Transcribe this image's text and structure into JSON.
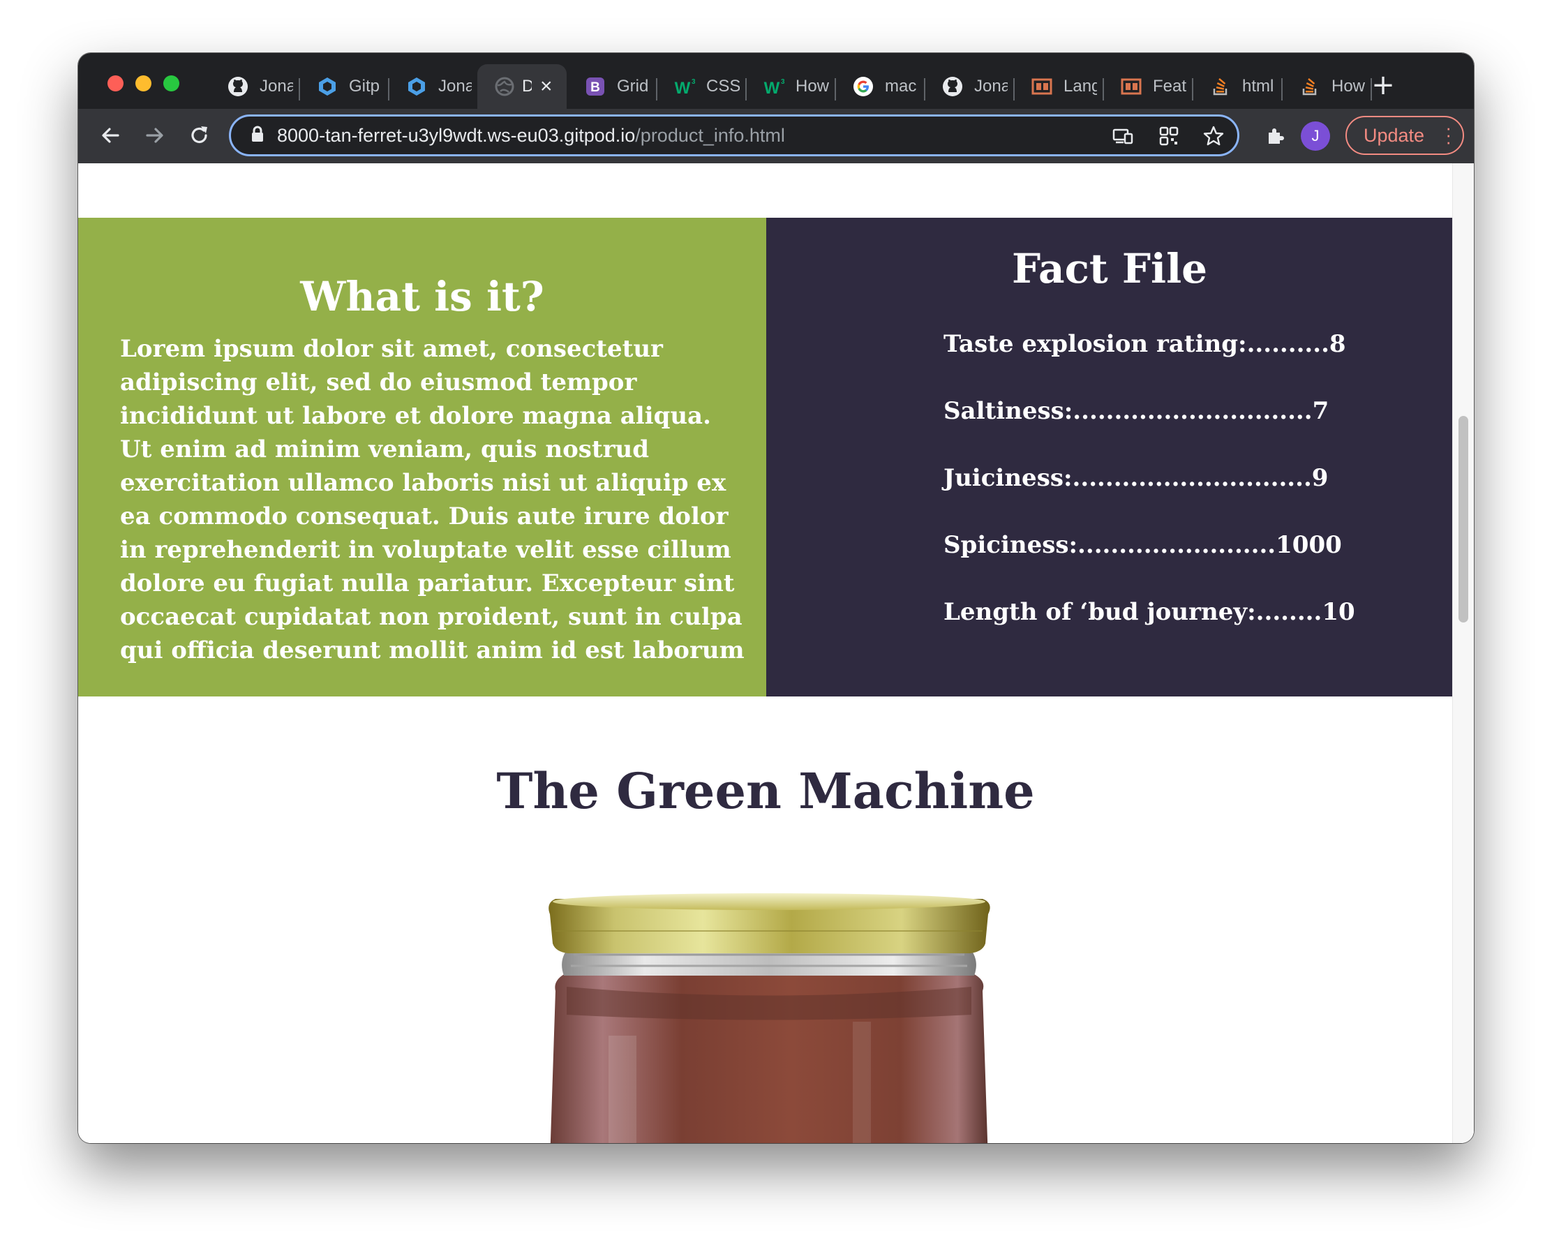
{
  "browser": {
    "tabs": [
      {
        "label": "Jona",
        "icon": "github-icon",
        "active": false
      },
      {
        "label": "Gitp",
        "icon": "gitpod-icon",
        "active": false
      },
      {
        "label": "Jona",
        "icon": "gitpod-icon",
        "active": false
      },
      {
        "label": "D",
        "icon": "globe-icon",
        "active": true
      },
      {
        "label": "Grid",
        "icon": "bootstrap-icon",
        "active": false
      },
      {
        "label": "CSS",
        "icon": "w3schools-icon",
        "active": false
      },
      {
        "label": "How",
        "icon": "w3schools-icon",
        "active": false
      },
      {
        "label": "mac",
        "icon": "google-icon",
        "active": false
      },
      {
        "label": "Jona",
        "icon": "github-icon",
        "active": false
      },
      {
        "label": "Lang",
        "icon": "caniuse-icon",
        "active": false
      },
      {
        "label": "Feat",
        "icon": "caniuse-icon",
        "active": false
      },
      {
        "label": "html",
        "icon": "stackoverflow-icon",
        "active": false
      },
      {
        "label": "How",
        "icon": "stackoverflow-icon",
        "active": false
      }
    ],
    "url_host": "8000-tan-ferret-u3yl9wdt.ws-eu03.gitpod.io",
    "url_path": "/product_info.html",
    "avatar_initial": "J",
    "update_label": "Update"
  },
  "page": {
    "what": {
      "title": "What is it?",
      "body": "Lorem ipsum dolor sit amet, consectetur adipiscing elit, sed do eiusmod tempor incididunt ut labore et dolore magna aliqua. Ut enim ad minim veniam, quis nostrud exercitation ullamco laboris nisi ut aliquip ex ea commodo consequat. Duis aute irure dolor in reprehenderit in voluptate velit esse cillum dolore eu fugiat nulla pariatur. Excepteur sint occaecat cupidatat non proident, sunt in culpa qui officia deserunt mollit anim id est laborum"
    },
    "fact_file": {
      "title": "Fact File",
      "items": [
        "Taste explosion rating:..........8",
        "Saltiness:.............................7",
        "Juiciness:.............................9",
        "Spiciness:........................1000",
        "Length of ‘bud journey:........10"
      ]
    },
    "product_title": "The Green Machine"
  },
  "colors": {
    "green_panel": "#94b049",
    "dark_panel": "#2f2a40"
  }
}
